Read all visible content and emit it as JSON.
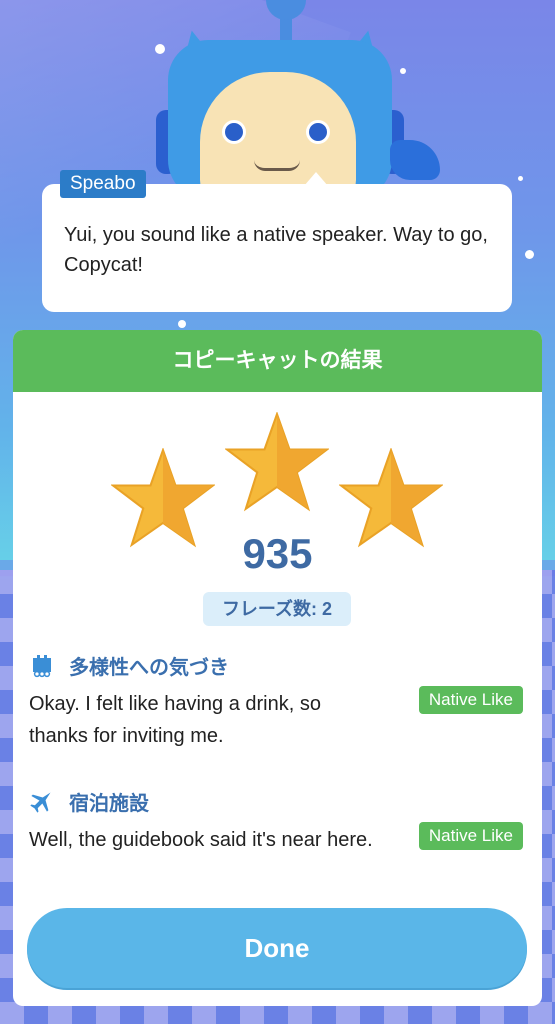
{
  "speech": {
    "speaker": "Speabo",
    "message": "Yui, you sound like a native speaker. Way to go, Copycat!"
  },
  "result": {
    "header": "コピーキャットの結果",
    "stars_earned": 3,
    "stars_total": 3,
    "score": "935",
    "phrase_count": "フレーズ数: 2"
  },
  "items": [
    {
      "icon": "kit-icon",
      "title": "多様性への気づき",
      "sentence": "Okay. I felt like having a drink, so thanks for inviting me.",
      "badge": "Native Like"
    },
    {
      "icon": "airplane-icon",
      "title": "宿泊施設",
      "sentence": "Well, the guidebook said it's near here.",
      "badge": "Native Like"
    }
  ],
  "actions": {
    "done_label": "Done"
  },
  "colors": {
    "header_green": "#5bbb5b",
    "title_blue": "#3a6fae",
    "button_blue": "#5ab6e8",
    "star_gold": "#f5b93a"
  }
}
